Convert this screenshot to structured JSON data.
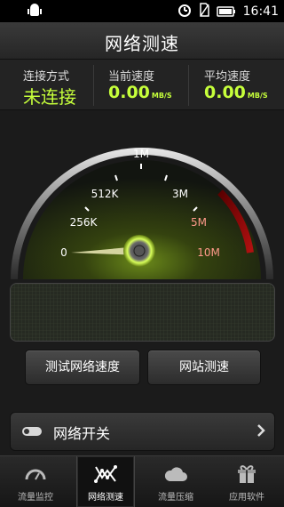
{
  "status": {
    "time": "16:41"
  },
  "app": {
    "title": "网络测速"
  },
  "stats": [
    {
      "label": "连接方式",
      "value": "未连接",
      "unit": ""
    },
    {
      "label": "当前速度",
      "value": "0.00",
      "unit": "MB/S"
    },
    {
      "label": "平均速度",
      "value": "0.00",
      "unit": "MB/S"
    }
  ],
  "gauge": {
    "ticks": [
      "0",
      "256K",
      "512K",
      "1M",
      "3M",
      "5M",
      "10M"
    ],
    "needle_value": "0"
  },
  "buttons": {
    "test": "测试网络速度",
    "website": "网站测速"
  },
  "switch_row": {
    "label": "网络开关"
  },
  "tabs": [
    {
      "label": "流量监控",
      "icon": "gauge-icon"
    },
    {
      "label": "网络测速",
      "icon": "network-icon"
    },
    {
      "label": "流量压缩",
      "icon": "cloud-icon"
    },
    {
      "label": "应用软件",
      "icon": "gift-icon"
    }
  ],
  "colors": {
    "accent_green": "#c6ff3b",
    "warm_tick": "#ff9a8a",
    "active_tab": "#111111"
  }
}
